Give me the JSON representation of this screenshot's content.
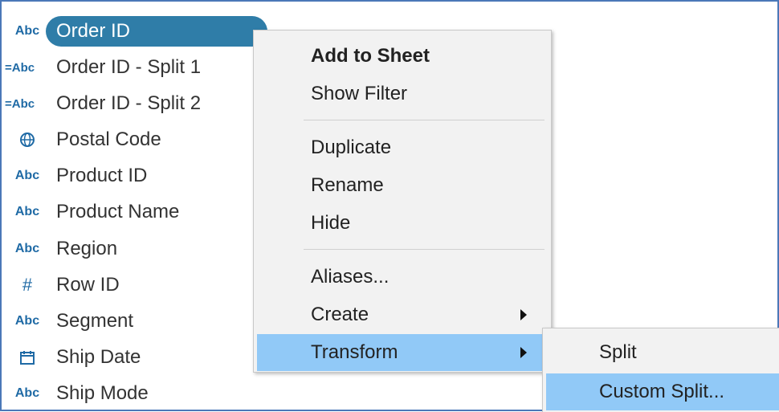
{
  "fields": [
    {
      "icon_text": "Abc",
      "icon": "string-type-icon",
      "label": "Order ID",
      "selected": true
    },
    {
      "icon_text": "=Abc",
      "icon": "calculated-string-type-icon",
      "label": "Order ID - Split 1"
    },
    {
      "icon_text": "=Abc",
      "icon": "calculated-string-type-icon",
      "label": "Order ID - Split 2"
    },
    {
      "icon_text": "🌐",
      "icon": "globe-icon",
      "label": "Postal Code"
    },
    {
      "icon_text": "Abc",
      "icon": "string-type-icon",
      "label": "Product ID"
    },
    {
      "icon_text": "Abc",
      "icon": "string-type-icon",
      "label": "Product Name"
    },
    {
      "icon_text": "Abc",
      "icon": "string-type-icon",
      "label": "Region"
    },
    {
      "icon_text": "#",
      "icon": "number-type-icon",
      "label": "Row ID"
    },
    {
      "icon_text": "Abc",
      "icon": "string-type-icon",
      "label": "Segment"
    },
    {
      "icon_text": "📅",
      "icon": "calendar-icon",
      "label": "Ship Date"
    },
    {
      "icon_text": "Abc",
      "icon": "string-type-icon",
      "label": "Ship Mode"
    }
  ],
  "context_menu": {
    "items": [
      {
        "label": "Add to Sheet",
        "bold": true
      },
      {
        "label": "Show Filter"
      },
      {
        "label": "Duplicate"
      },
      {
        "label": "Rename"
      },
      {
        "label": "Hide"
      },
      {
        "label": "Aliases..."
      },
      {
        "label": "Create",
        "has_submenu": true
      },
      {
        "label": "Transform",
        "has_submenu": true,
        "active": true
      }
    ]
  },
  "transform_submenu": {
    "items": [
      {
        "label": "Split"
      },
      {
        "label": "Custom Split...",
        "active": true
      }
    ]
  },
  "colors": {
    "selected_pill": "#2f7da8",
    "menu_highlight": "#91c9f7",
    "menu_background": "#f2f2f2",
    "frame_border": "#4a78b8"
  }
}
